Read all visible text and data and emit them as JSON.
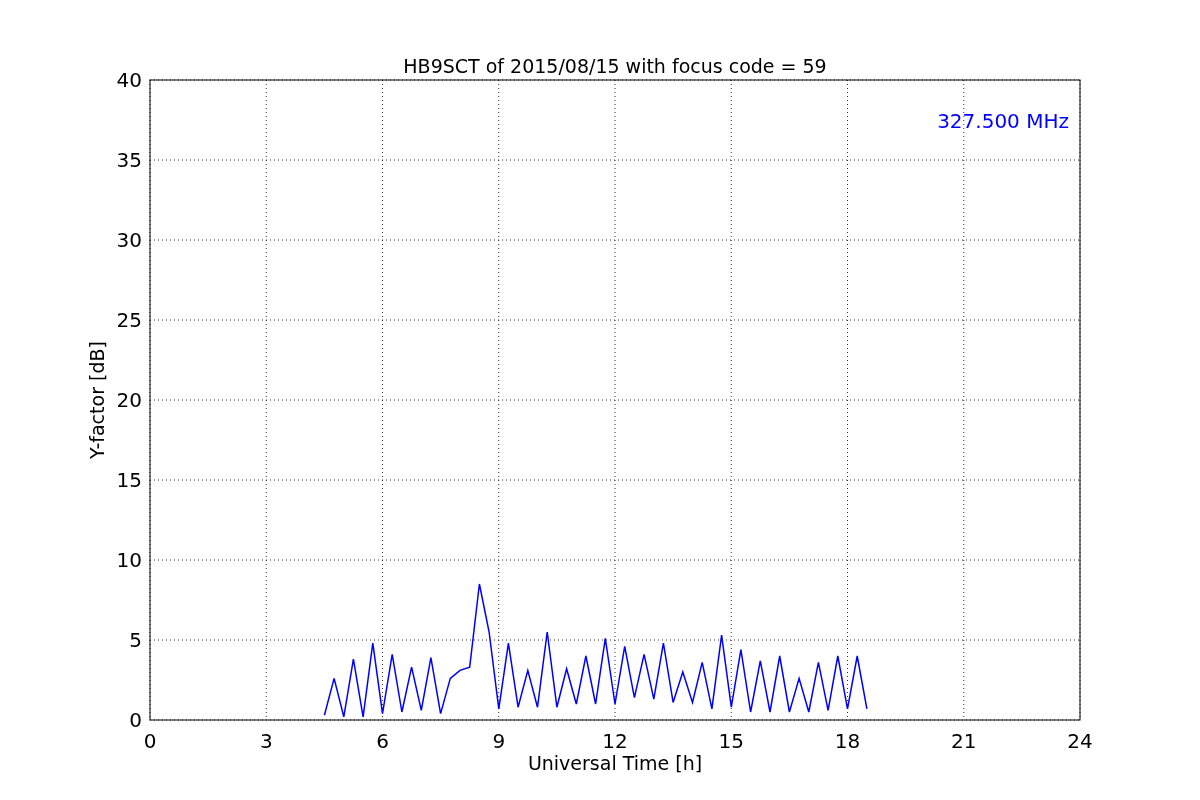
{
  "chart_data": {
    "type": "line",
    "title": "HB9SCT of 2015/08/15 with focus code = 59",
    "xlabel": "Universal Time [h]",
    "ylabel": "Y-factor [dB]",
    "x": [
      4.5,
      4.75,
      5.0,
      5.25,
      5.5,
      5.75,
      6.0,
      6.25,
      6.5,
      6.75,
      7.0,
      7.25,
      7.5,
      7.75,
      8.0,
      8.25,
      8.5,
      8.75,
      9.0,
      9.25,
      9.5,
      9.75,
      10.0,
      10.25,
      10.5,
      10.75,
      11.0,
      11.25,
      11.5,
      11.75,
      12.0,
      12.25,
      12.5,
      12.75,
      13.0,
      13.25,
      13.5,
      13.75,
      14.0,
      14.25,
      14.5,
      14.75,
      15.0,
      15.25,
      15.5,
      15.75,
      16.0,
      16.25,
      16.5,
      16.75,
      17.0,
      17.25,
      17.5,
      17.75,
      18.0,
      18.25,
      18.5
    ],
    "series": [
      {
        "name": "327.500 MHz",
        "color": "#0000ff",
        "values": [
          0.3,
          2.6,
          0.2,
          3.8,
          0.2,
          4.8,
          0.4,
          4.1,
          0.5,
          3.3,
          0.6,
          3.9,
          0.4,
          2.6,
          3.1,
          3.3,
          8.5,
          5.5,
          0.7,
          4.8,
          0.8,
          3.1,
          0.8,
          5.5,
          0.8,
          3.2,
          1.0,
          4.0,
          1.0,
          5.1,
          1.0,
          4.6,
          1.4,
          4.1,
          1.3,
          4.8,
          1.1,
          3.0,
          1.1,
          3.6,
          0.7,
          5.3,
          0.8,
          4.4,
          0.5,
          3.7,
          0.5,
          4.0,
          0.5,
          2.6,
          0.5,
          3.6,
          0.6,
          4.0,
          0.7,
          4.0,
          0.7
        ]
      }
    ],
    "xlim": [
      0,
      24
    ],
    "ylim": [
      0,
      40
    ],
    "xticks": [
      0,
      3,
      6,
      9,
      12,
      15,
      18,
      21,
      24
    ],
    "yticks": [
      0,
      5,
      10,
      15,
      20,
      25,
      30,
      35,
      40
    ],
    "grid": true
  }
}
